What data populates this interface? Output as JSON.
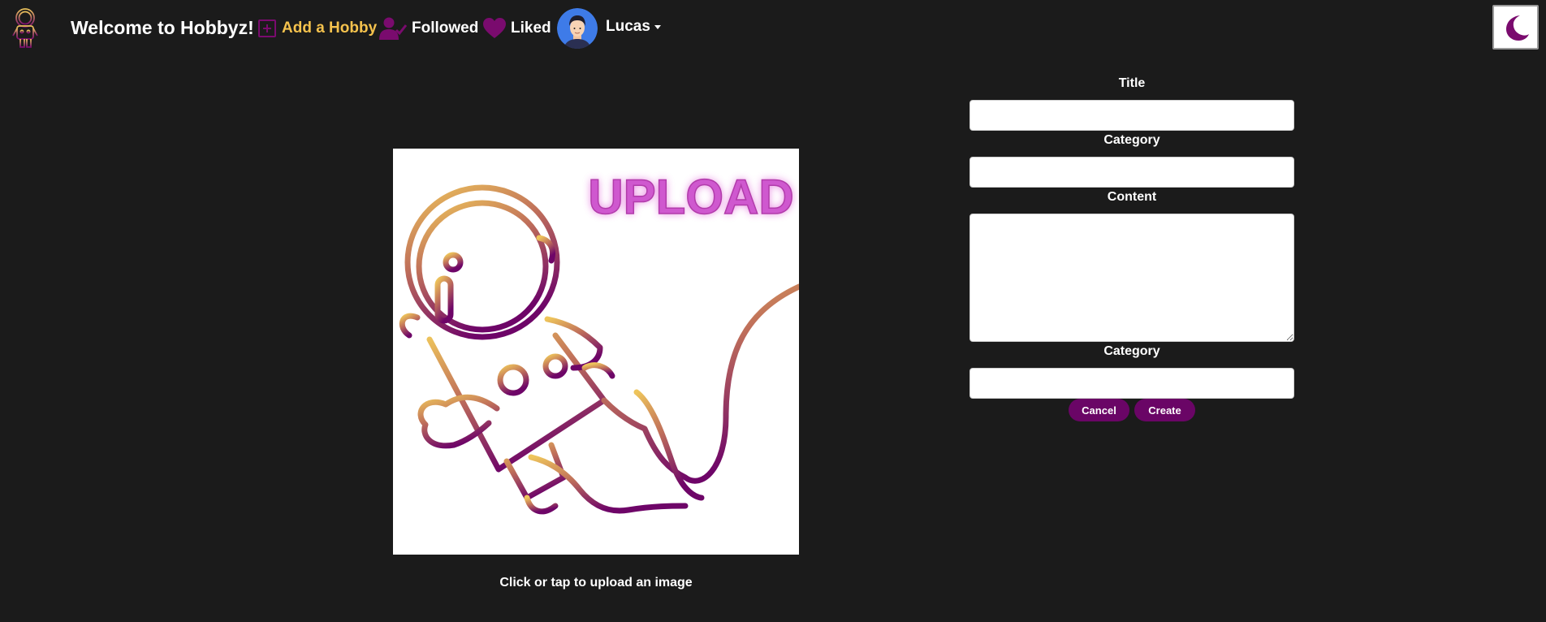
{
  "app": {
    "brand_title": "Welcome to Hobbyz!"
  },
  "nav": {
    "add_hobby": "Add a Hobby",
    "followed": "Followed",
    "liked": "Liked",
    "user_name": "Lucas"
  },
  "colors": {
    "accent": "#6a0566",
    "add_hobby": "#f5c24d",
    "background": "#1b1b1b"
  },
  "upload": {
    "image_text": "UPLOAD",
    "hint": "Click or tap to upload an image"
  },
  "form": {
    "title_label": "Title",
    "title_value": "",
    "category_label": "Category",
    "category_value": "",
    "content_label": "Content",
    "content_value": "",
    "category2_label": "Category",
    "category2_value": "",
    "cancel_label": "Cancel",
    "create_label": "Create"
  },
  "icons": {
    "logo": "astronaut-logo-icon",
    "add_hobby": "plus-square-icon",
    "followed": "user-check-icon",
    "liked": "heart-icon",
    "theme": "moon-icon",
    "user_menu": "caret-down-icon"
  }
}
